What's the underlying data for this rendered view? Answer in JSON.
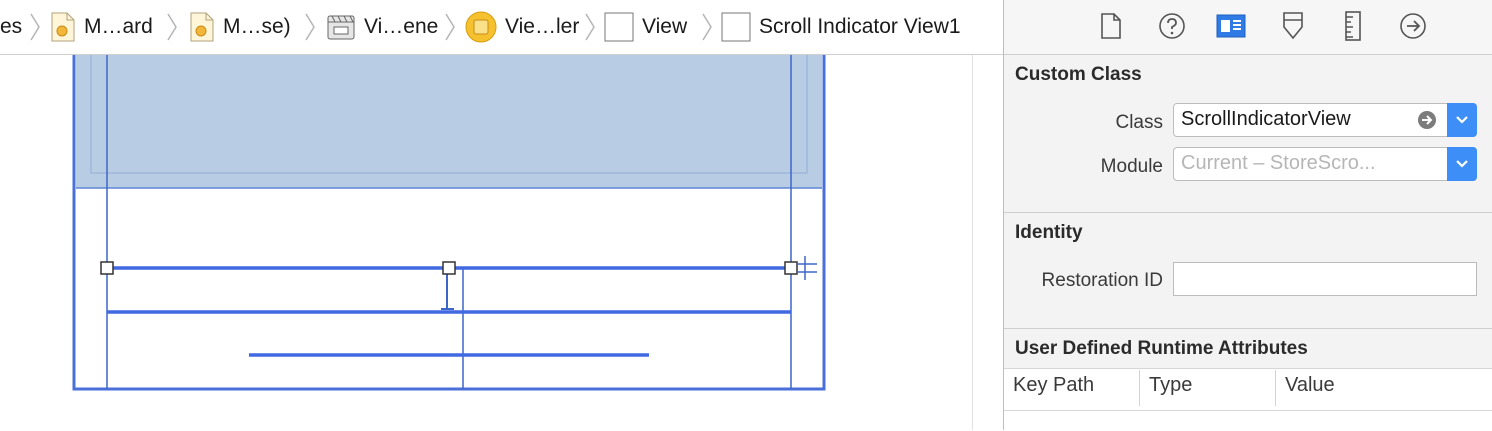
{
  "breadcrumb": {
    "items": [
      {
        "label": "es",
        "icon": "folder-icon"
      },
      {
        "label": "M…ard",
        "icon": "storyboard-icon"
      },
      {
        "label": "M…se)",
        "icon": "storyboard-icon"
      },
      {
        "label": "Vi…ene",
        "icon": "scene-icon"
      },
      {
        "label": "Vie…ler",
        "icon": "view-controller-icon"
      },
      {
        "label": "View",
        "icon": "view-icon"
      },
      {
        "label": "Scroll Indicator View1",
        "icon": "view-icon"
      }
    ]
  },
  "inspector": {
    "toolbar": [
      "file-inspector-icon",
      "quick-help-icon",
      "identity-inspector-icon",
      "attributes-inspector-icon",
      "size-inspector-icon",
      "connections-inspector-icon"
    ],
    "custom_class": {
      "title": "Custom Class",
      "class_label": "Class",
      "class_value": "ScrollIndicatorView",
      "module_label": "Module",
      "module_placeholder": "Current – StoreScro..."
    },
    "identity": {
      "title": "Identity",
      "restoration_label": "Restoration ID",
      "restoration_value": ""
    },
    "runtime_attributes": {
      "title": "User Defined Runtime Attributes",
      "columns": [
        "Key Path",
        "Type",
        "Value"
      ]
    }
  },
  "colors": {
    "accent": "#3e8ef7",
    "selection": "#4169e1",
    "container_fill": "#b8cce4"
  }
}
